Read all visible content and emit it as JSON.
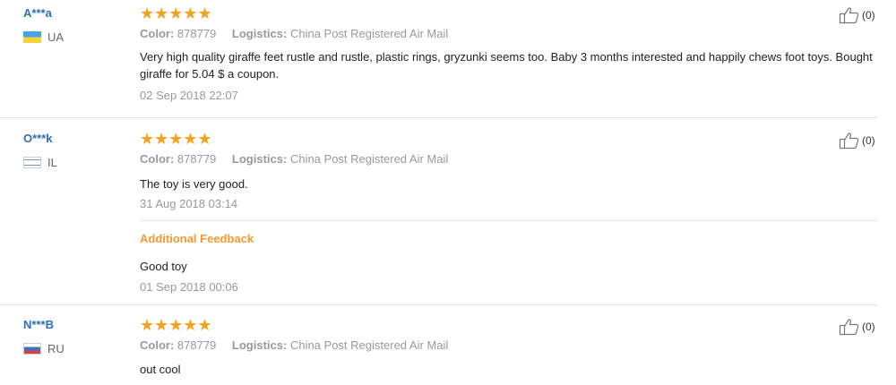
{
  "labels": {
    "color": "Color:",
    "logistics": "Logistics:",
    "additional_feedback": "Additional Feedback"
  },
  "stars": "★★★★★",
  "reviews": [
    {
      "user": "A***a",
      "country": "UA",
      "rating": 5,
      "color": "878779",
      "logistics": "China Post Registered Air Mail",
      "text": "Very high quality giraffe feet rustle and rustle, plastic rings, gryzunki seems too. Baby 3 months interested and happily chews foot toys. Bought giraffe for 5.04 $ a coupon.",
      "date": "02 Sep 2018 22:07",
      "likes": "(0)"
    },
    {
      "user": "O***k",
      "country": "IL",
      "rating": 5,
      "color": "878779",
      "logistics": "China Post Registered Air Mail",
      "text": "The toy is very good.",
      "date": "31 Aug 2018 03:14",
      "additional_text": "Good toy",
      "additional_date": "01 Sep 2018 00:06",
      "likes": "(0)"
    },
    {
      "user": "N***B",
      "country": "RU",
      "rating": 5,
      "color": "878779",
      "logistics": "China Post Registered Air Mail",
      "text": "out cool",
      "likes": "(0)"
    }
  ]
}
